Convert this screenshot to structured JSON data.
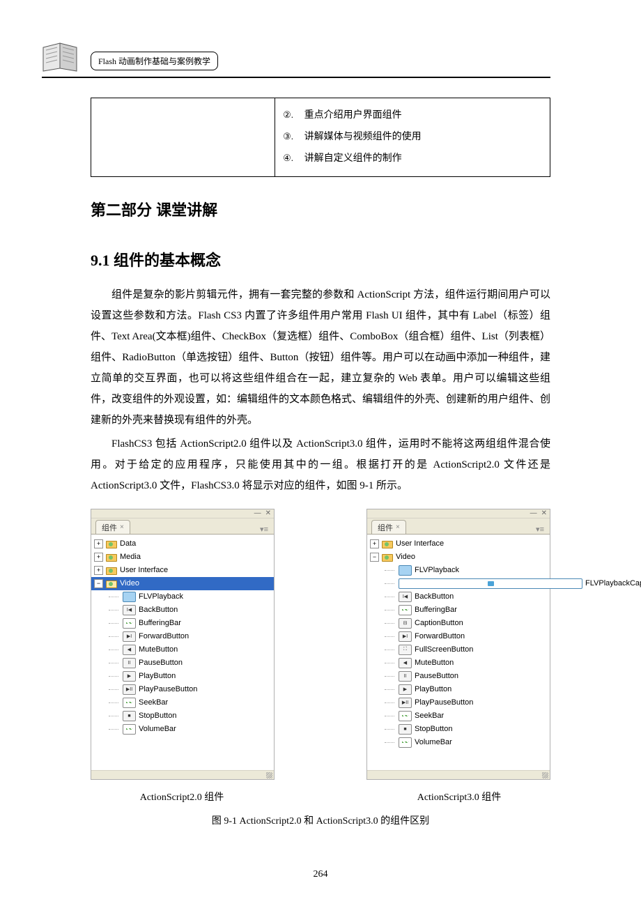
{
  "header": {
    "chapter_title": "Flash 动画制作基础与案例教学"
  },
  "objectives": {
    "items": [
      {
        "num": "②.",
        "text": "重点介绍用户界面组件"
      },
      {
        "num": "③.",
        "text": "讲解媒体与视频组件的使用"
      },
      {
        "num": "④.",
        "text": "讲解自定义组件的制作"
      }
    ]
  },
  "headings": {
    "part": "第二部分  课堂讲解",
    "s91": "9.1   组件的基本概念"
  },
  "paragraphs": {
    "p1": "组件是复杂的影片剪辑元件，拥有一套完整的参数和 ActionScript 方法，组件运行期间用户可以设置这些参数和方法。Flash CS3 内置了许多组件用户常用 Flash UI 组件，其中有 Label（标签）组件、Text Area(文本框)组件、CheckBox（复选框）组件、ComboBox（组合框）组件、List（列表框）组件、RadioButton（单选按钮）组件、Button（按钮）组件等。用户可以在动画中添加一种组件，建立简单的交互界面，也可以将这些组件组合在一起，建立复杂的 Web 表单。用户可以编辑这些组件，改变组件的外观设置，如：编辑组件的文本颜色格式、编辑组件的外壳、创建新的用户组件、创建新的外壳来替换现有组件的外壳。",
    "p2": "FlashCS3 包括 ActionScript2.0 组件以及 ActionScript3.0 组件，运用时不能将这两组组件混合使用。对于给定的应用程序，只能使用其中的一组。根据打开的是 ActionScript2.0 文件还是 ActionScript3.0 文件，FlashCS3.0 将显示对应的组件，如图 9-1 所示。"
  },
  "panels": {
    "tab_label": "组件",
    "left": {
      "folders": [
        {
          "label": "Data",
          "expanded": false
        },
        {
          "label": "Media",
          "expanded": false
        },
        {
          "label": "User Interface",
          "expanded": false
        },
        {
          "label": "Video",
          "expanded": true,
          "selected": true
        }
      ],
      "children": [
        "FLVPlayback",
        "BackButton",
        "BufferingBar",
        "ForwardButton",
        "MuteButton",
        "PauseButton",
        "PlayButton",
        "PlayPauseButton",
        "SeekBar",
        "StopButton",
        "VolumeBar"
      ]
    },
    "right": {
      "folders": [
        {
          "label": "User Interface",
          "expanded": false
        },
        {
          "label": "Video",
          "expanded": true,
          "selected": false
        }
      ],
      "children": [
        "FLVPlayback",
        "FLVPlaybackCaptioning",
        "BackButton",
        "BufferingBar",
        "CaptionButton",
        "ForwardButton",
        "FullScreenButton",
        "MuteButton",
        "PauseButton",
        "PlayButton",
        "PlayPauseButton",
        "SeekBar",
        "StopButton",
        "VolumeBar"
      ]
    }
  },
  "captions": {
    "left": "ActionScript2.0 组件",
    "right": "ActionScript3.0 组件",
    "fig": "图 9-1 ActionScript2.0 和 ActionScript3.0 的组件区别"
  },
  "page_number": "264"
}
